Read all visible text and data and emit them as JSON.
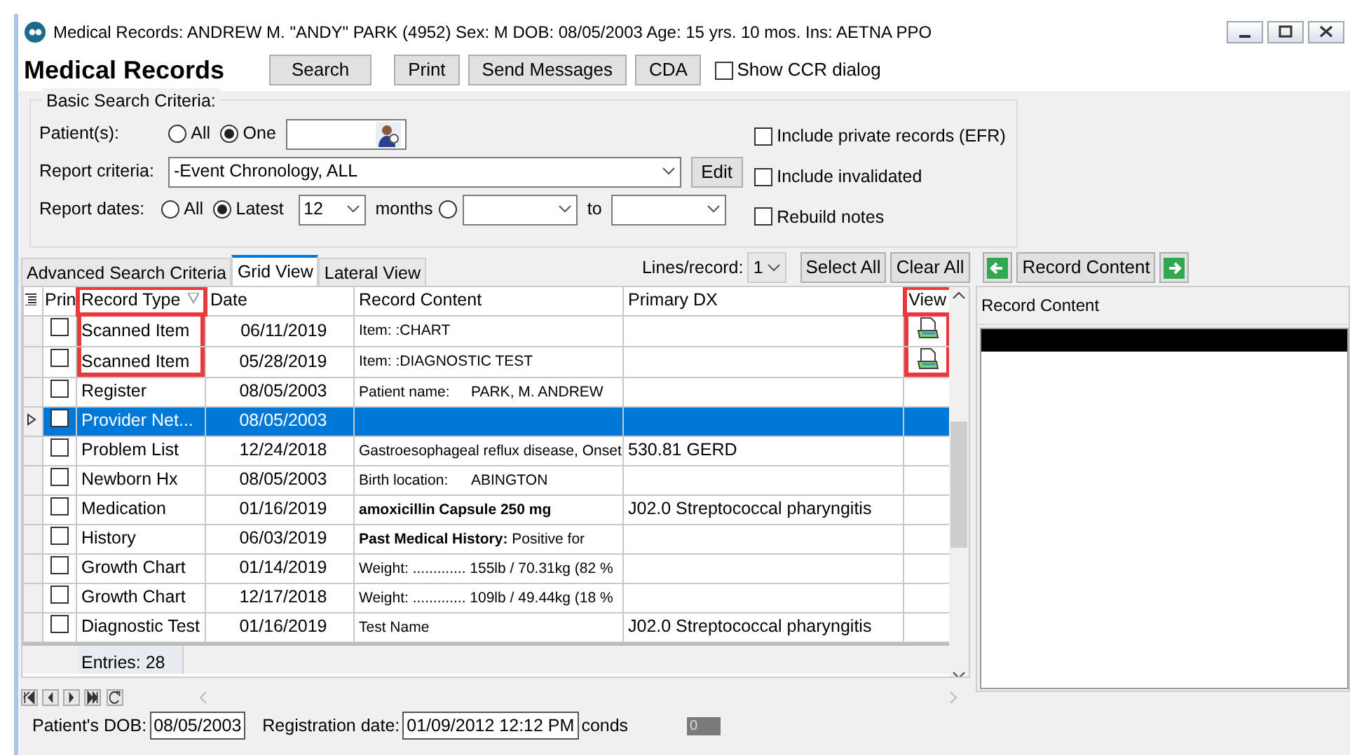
{
  "window": {
    "title": "Medical Records: ANDREW M. \"ANDY\" PARK (4952)  Sex: M  DOB: 08/05/2003  Age: 15 yrs. 10 mos.  Ins: AETNA PPO"
  },
  "header": {
    "title": "Medical Records",
    "buttons": [
      "Search",
      "Print",
      "Send Messages",
      "CDA"
    ],
    "show_ccr": {
      "label": "Show CCR dialog",
      "checked": false
    }
  },
  "search": {
    "legend": "Basic Search Criteria:",
    "patients": {
      "label": "Patient(s):",
      "options": [
        {
          "label": "All",
          "selected": false
        },
        {
          "label": "One",
          "selected": true
        }
      ]
    },
    "criteria": {
      "label": "Report criteria:",
      "value": "-Event Chronology, ALL",
      "edit": "Edit"
    },
    "dates": {
      "label": "Report dates:",
      "options": [
        {
          "label": "All",
          "selected": false
        },
        {
          "label": "Latest",
          "selected": true
        }
      ],
      "months_value": "12",
      "months_label": "months",
      "range_selected": false,
      "to_label": "to"
    },
    "checks": [
      {
        "label": "Include private records (EFR)",
        "checked": false
      },
      {
        "label": "Include invalidated",
        "checked": false
      },
      {
        "label": "Rebuild notes",
        "checked": false
      }
    ]
  },
  "tabs": [
    {
      "label": "Advanced Search Criteria",
      "selected": false
    },
    {
      "label": "Grid View",
      "selected": true
    },
    {
      "label": "Lateral View",
      "selected": false
    }
  ],
  "toolbar": {
    "lines_label": "Lines/record:",
    "lines_value": "1",
    "select_all": "Select All",
    "clear_all": "Clear All",
    "content_button": "Record Content"
  },
  "table": {
    "columns": [
      {
        "label": "Prin",
        "highlighted": false
      },
      {
        "label": "Record Type",
        "highlighted": true
      },
      {
        "label": "Date",
        "highlighted": false
      },
      {
        "label": "Record Content",
        "highlighted": false
      },
      {
        "label": "Primary DX",
        "highlighted": false
      },
      {
        "label": "View",
        "highlighted": true
      }
    ],
    "rows": [
      {
        "type": "Scanned Item",
        "date": "06/11/2019",
        "content": "Item: :CHART",
        "view": true,
        "selected": false,
        "checked": false
      },
      {
        "type": "Scanned Item",
        "date": "05/28/2019",
        "content": "Item: :DIAGNOSTIC TEST",
        "view": true,
        "selected": false,
        "checked": false
      },
      {
        "type": "Register",
        "date": "08/05/2003",
        "content": "Patient name:",
        "content_value": "PARK, M. ANDREW",
        "view": false,
        "selected": false,
        "checked": false
      },
      {
        "type": "Provider Net...",
        "date": "08/05/2003",
        "view": false,
        "selected": true,
        "checked": false
      },
      {
        "type": "Problem List",
        "date": "12/24/2018",
        "content": "Gastroesophageal reflux disease, Onset",
        "dx": "530.81 GERD",
        "view": false,
        "selected": false,
        "checked": false
      },
      {
        "type": "Newborn Hx",
        "date": "08/05/2003",
        "content": "Birth location:",
        "content_value": "ABINGTON",
        "view": false,
        "selected": false,
        "checked": false
      },
      {
        "type": "Medication",
        "date": "01/16/2019",
        "content": "amoxicillin Capsule 250 mg",
        "content_bold": true,
        "dx": "J02.0 Streptococcal pharyngitis",
        "view": false,
        "selected": false,
        "checked": false
      },
      {
        "type": "History",
        "date": "06/03/2019",
        "content": "**Past Medical History:** Positive for",
        "view": false,
        "selected": false,
        "checked": false
      },
      {
        "type": "Growth Chart",
        "date": "01/14/2019",
        "content": "Weight: ............. 155lb / 70.31kg (82 %",
        "view": false,
        "selected": false,
        "checked": false
      },
      {
        "type": "Growth Chart",
        "date": "12/17/2018",
        "content": "Weight: ............. 109lb / 49.44kg (18 %",
        "view": false,
        "selected": false,
        "checked": false
      },
      {
        "type": "Diagnostic Test",
        "date": "01/16/2019",
        "content": "Test Name",
        "dx": "J02.0 Streptococcal pharyngitis",
        "view": false,
        "selected": false,
        "checked": false
      }
    ],
    "entries": "Entries: 28"
  },
  "preview": {
    "title": "Record Content"
  },
  "footer": {
    "dob_label": "Patient's DOB:",
    "dob": "08/05/2003",
    "reg_label": "Registration date:",
    "reg": "01/09/2012 12:12 PM",
    "seconds": "conds",
    "counter": "0"
  }
}
